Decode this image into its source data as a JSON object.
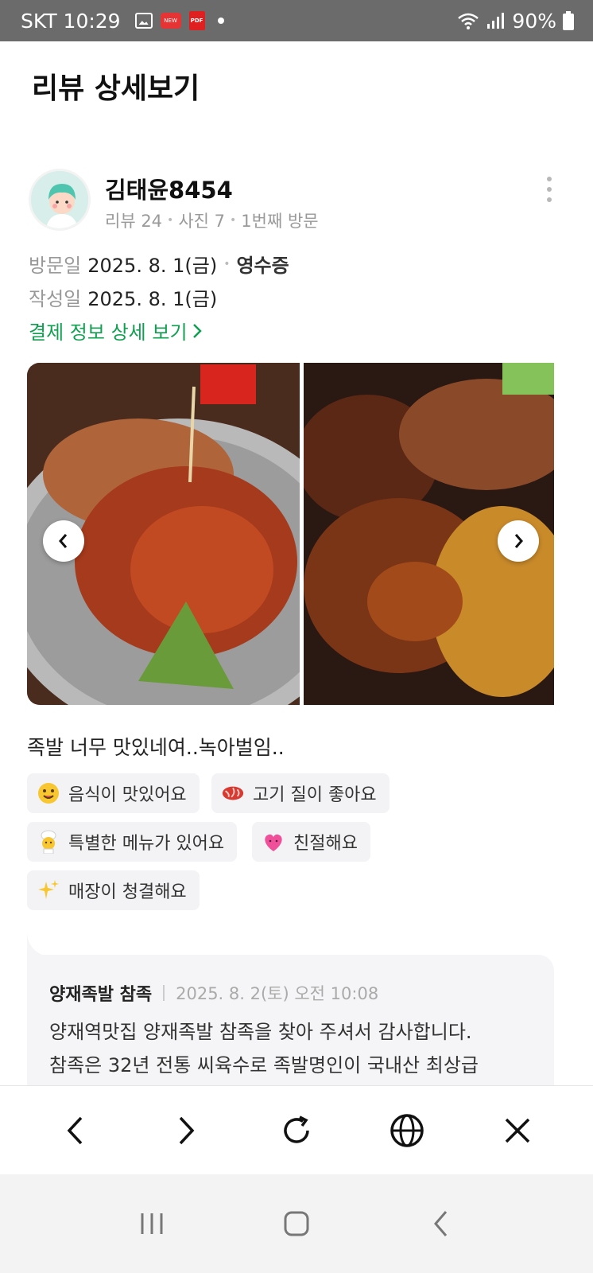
{
  "status_bar": {
    "carrier_time": "SKT 10:29",
    "red_badge": "NEW",
    "pdf_badge": "PDF",
    "battery": "90%"
  },
  "header": {
    "title": "리뷰 상세보기"
  },
  "reviewer": {
    "name": "김태윤8454",
    "reviews": "리뷰 24",
    "photos": "사진 7",
    "visits": "1번째 방문"
  },
  "visit": {
    "visit_label": "방문일",
    "visit_date": "2025. 8. 1(금)",
    "receipt": "영수증",
    "written_label": "작성일",
    "written_date": "2025. 8. 1(금)",
    "payment_link": "결제 정보 상세 보기"
  },
  "review": {
    "text": "족발 너무 맛있네여..녹아벌임.."
  },
  "tags": [
    {
      "label": "음식이 맛있어요",
      "icon": "smiling-face-icon"
    },
    {
      "label": "고기 질이 좋아요",
      "icon": "meat-icon"
    },
    {
      "label": "특별한 메뉴가 있어요",
      "icon": "chef-icon"
    },
    {
      "label": "친절해요",
      "icon": "heart-icon"
    },
    {
      "label": "매장이 청결해요",
      "icon": "sparkles-icon"
    }
  ],
  "reply": {
    "store": "양재족발 참족",
    "date": "2025. 8. 2(토) 오전 10:08",
    "line1": "양재역맛집 양재족발 참족을 찾아 주셔서 감사합니다.",
    "line2": "참족은 32년 전통 씨육수로 족발명인이 국내산 최상급"
  },
  "colors": {
    "accent_green": "#10a050",
    "status_bar": "#6b6b6b",
    "tag_bg": "#f3f3f5"
  }
}
